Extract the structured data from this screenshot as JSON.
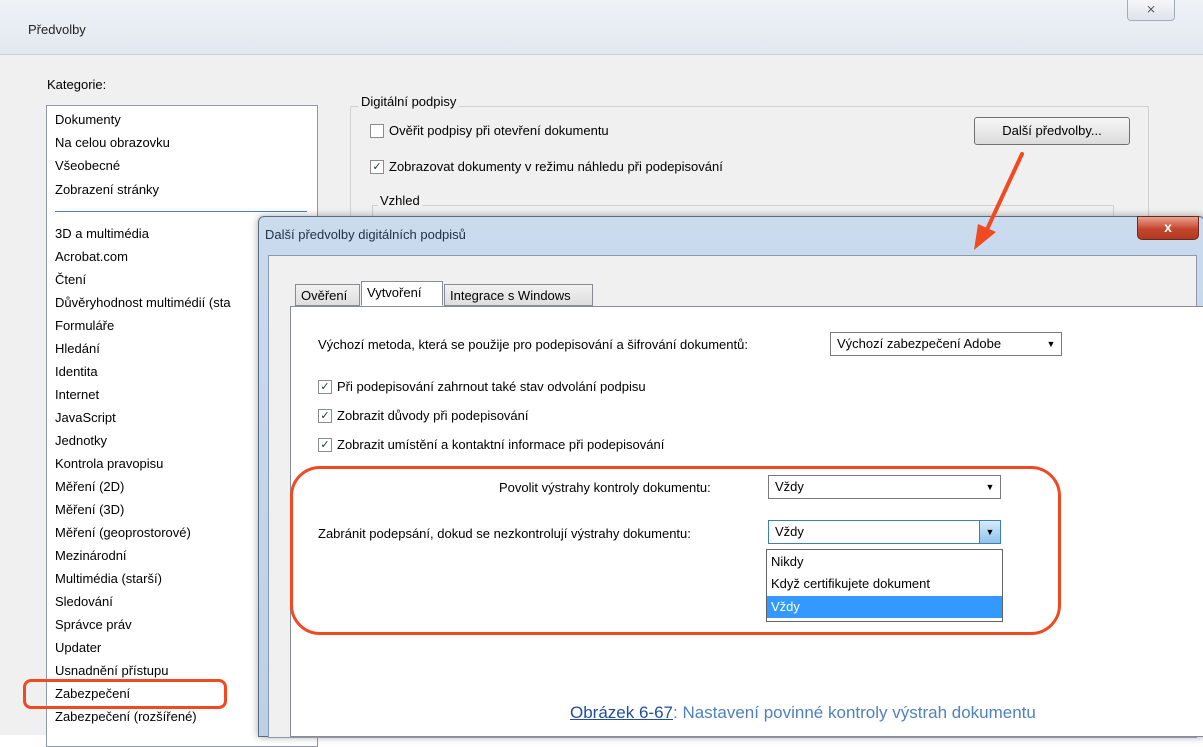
{
  "outer_window": {
    "title": "Předvolby",
    "close_glyph": "⨯",
    "category_label": "Kategorie:",
    "categories_top": [
      "Dokumenty",
      "Na celou obrazovku",
      "Všeobecné",
      "Zobrazení stránky"
    ],
    "categories": [
      "3D a multimédia",
      "Acrobat.com",
      "Čtení",
      "Důvěryhodnost multimédií (sta",
      "Formuláře",
      "Hledání",
      "Identita",
      "Internet",
      "JavaScript",
      "Jednotky",
      "Kontrola pravopisu",
      "Měření (2D)",
      "Měření (3D)",
      "Měření (geoprostorové)",
      "Mezinárodní",
      "Multimédia (starší)",
      "Sledování",
      "Správce práv",
      "Updater",
      "Usnadnění přístupu",
      "Zabezpečení",
      "Zabezpečení (rozšířené)"
    ],
    "digital_signatures": {
      "legend": "Digitální podpisy",
      "verify_label": "Ověřit podpisy při otevření dokumentu",
      "verify_checked": false,
      "preview_label": "Zobrazovat dokumenty v režimu náhledu při podepisování",
      "preview_checked": true,
      "more_button": "Další předvolby...",
      "appearance_legend": "Vzhled"
    }
  },
  "dialog": {
    "title": "Další předvolby digitálních podpisů",
    "close_glyph": "x",
    "tabs": [
      "Ověření",
      "Vytvoření",
      "Integrace s Windows"
    ],
    "active_tab": "Vytvoření",
    "method_label": "Výchozí metoda, která se použije pro podepisování a šifrování dokumentů:",
    "method_value": "Výchozí zabezpečení Adobe",
    "checkboxes": [
      {
        "label": "Při podepisování zahrnout také stav odvolání podpisu",
        "checked": true
      },
      {
        "label": "Zobrazit důvody při podepisování",
        "checked": true
      },
      {
        "label": "Zobrazit umístění a kontaktní informace při podepisování",
        "checked": true
      }
    ],
    "warnings_label": "Povolit výstrahy kontroly dokumentu:",
    "warnings_value": "Vždy",
    "prevent_label": "Zabránit podepsání, dokud se nezkontrolují výstrahy dokumentu:",
    "prevent_value": "Vždy",
    "prevent_options": [
      "Nikdy",
      "Když certifikujete dokument",
      "Vždy"
    ],
    "prevent_selected": "Vždy"
  },
  "caption": {
    "link": "Obrázek 6-67",
    "text": ": Nastavení povinné kontroly výstrah dokumentu"
  },
  "colors": {
    "annotation": "#f04a23",
    "caption": "#4f81bd",
    "selection": "#3399ff"
  }
}
